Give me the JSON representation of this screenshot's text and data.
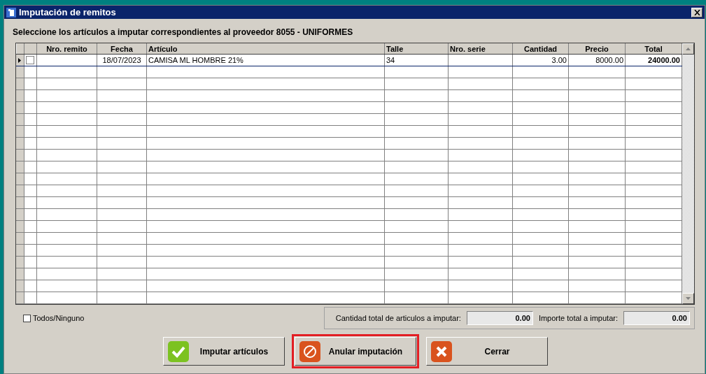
{
  "window": {
    "title": "Imputación de remitos"
  },
  "instruction": "Seleccione los artículos a imputar correspondientes al proveedor 8055 - UNIFORMES",
  "table": {
    "columns": [
      "Nro. remito",
      "Fecha",
      "Artículo",
      "Talle",
      "Nro. serie",
      "Cantidad",
      "Precio",
      "Total"
    ],
    "rows": [
      {
        "current": true,
        "checked": false,
        "cells": [
          "",
          "18/07/2023",
          "CAMISA ML HOMBRE 21%",
          "34",
          "",
          "3.00",
          "8000.00",
          "24000.00"
        ]
      }
    ]
  },
  "select_all": {
    "label": "Todos/Ninguno",
    "checked": false
  },
  "totals": [
    {
      "label": "Cantidad total de articulos a imputar:",
      "value": "0.00"
    },
    {
      "label": "Importe total a imputar:",
      "value": "0.00"
    }
  ],
  "buttons": [
    {
      "kind": "accept",
      "label": "Imputar artículos",
      "highlighted": false
    },
    {
      "kind": "cancel",
      "label": "Anular imputación",
      "highlighted": true
    },
    {
      "kind": "close",
      "label": "Cerrar",
      "highlighted": false
    }
  ]
}
